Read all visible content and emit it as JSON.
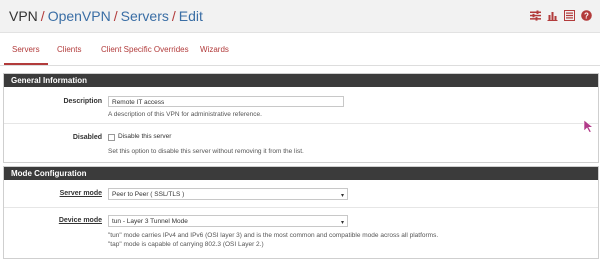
{
  "breadcrumb": {
    "items": [
      "VPN",
      "OpenVPN",
      "Servers",
      "Edit"
    ],
    "separator": "/"
  },
  "header_icons": [
    "sliders-icon",
    "bar-chart-icon",
    "list-icon",
    "help-icon"
  ],
  "tabs": [
    {
      "label": "Servers",
      "active": true
    },
    {
      "label": "Clients",
      "active": false
    },
    {
      "label": "Client Specific Overrides",
      "active": false
    },
    {
      "label": "Wizards",
      "active": false
    }
  ],
  "general": {
    "title": "General Information",
    "description": {
      "label": "Description",
      "value": "Remote IT access",
      "help": "A description of this VPN for administrative reference."
    },
    "disabled": {
      "label": "Disabled",
      "checkbox_label": "Disable this server",
      "checked": false,
      "help": "Set this option to disable this server without removing it from the list."
    }
  },
  "mode": {
    "title": "Mode Configuration",
    "server_mode": {
      "label": "Server mode",
      "value": "Peer to Peer ( SSL/TLS )"
    },
    "device_mode": {
      "label": "Device mode",
      "value": "tun - Layer 3 Tunnel Mode",
      "help1": "\"tun\" mode carries IPv4 and IPv6 (OSI layer 3) and is the most common and compatible mode across all platforms.",
      "help2": "\"tap\" mode is capable of carrying 802.3 (OSI Layer 2.)"
    }
  },
  "colors": {
    "accent": "#b23b3b",
    "link": "#3a6ea5",
    "panel_header": "#3b3b3b"
  }
}
